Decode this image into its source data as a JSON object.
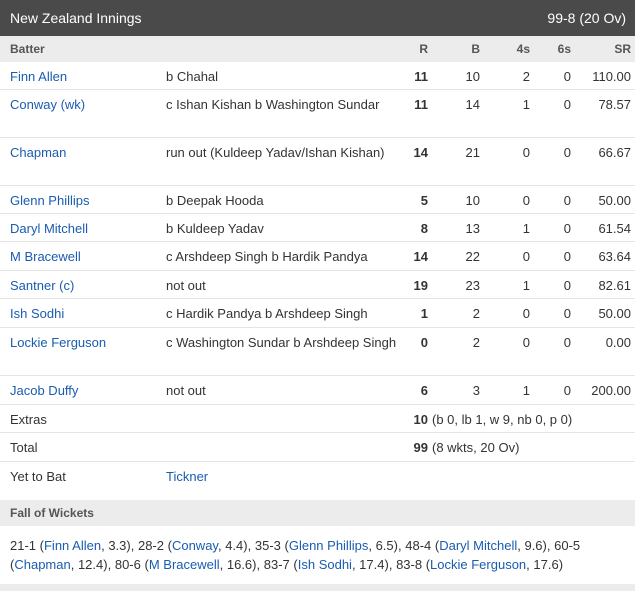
{
  "header": {
    "title": "New Zealand Innings",
    "score": "99-8 (20 Ov)"
  },
  "columns": {
    "batter": "Batter",
    "r": "R",
    "b": "B",
    "fours": "4s",
    "sixes": "6s",
    "sr": "SR"
  },
  "batters": [
    {
      "name": "Finn Allen",
      "dismissal": "b Chahal",
      "r": "11",
      "b": "10",
      "fours": "2",
      "sixes": "0",
      "sr": "110.00"
    },
    {
      "name": "Conway (wk)",
      "dismissal": "c Ishan Kishan b Washington Sundar",
      "r": "11",
      "b": "14",
      "fours": "1",
      "sixes": "0",
      "sr": "78.57"
    },
    {
      "name": "Chapman",
      "dismissal": "run out (Kuldeep Yadav/Ishan Kishan)",
      "r": "14",
      "b": "21",
      "fours": "0",
      "sixes": "0",
      "sr": "66.67"
    },
    {
      "name": "Glenn Phillips",
      "dismissal": "b Deepak Hooda",
      "r": "5",
      "b": "10",
      "fours": "0",
      "sixes": "0",
      "sr": "50.00"
    },
    {
      "name": "Daryl Mitchell",
      "dismissal": "b Kuldeep Yadav",
      "r": "8",
      "b": "13",
      "fours": "1",
      "sixes": "0",
      "sr": "61.54"
    },
    {
      "name": "M Bracewell",
      "dismissal": "c Arshdeep Singh b Hardik Pandya",
      "r": "14",
      "b": "22",
      "fours": "0",
      "sixes": "0",
      "sr": "63.64"
    },
    {
      "name": "Santner (c)",
      "dismissal": "not out",
      "r": "19",
      "b": "23",
      "fours": "1",
      "sixes": "0",
      "sr": "82.61"
    },
    {
      "name": "Ish Sodhi",
      "dismissal": "c Hardik Pandya b Arshdeep Singh",
      "r": "1",
      "b": "2",
      "fours": "0",
      "sixes": "0",
      "sr": "50.00"
    },
    {
      "name": "Lockie Ferguson",
      "dismissal": "c Washington Sundar b Arshdeep Singh",
      "r": "0",
      "b": "2",
      "fours": "0",
      "sixes": "0",
      "sr": "0.00"
    },
    {
      "name": "Jacob Duffy",
      "dismissal": "not out",
      "r": "6",
      "b": "3",
      "fours": "1",
      "sixes": "0",
      "sr": "200.00"
    }
  ],
  "extras": {
    "label": "Extras",
    "value": "10",
    "detail": "(b 0, lb 1, w 9, nb 0, p 0)"
  },
  "total": {
    "label": "Total",
    "value": "99",
    "detail": "(8 wkts, 20 Ov)"
  },
  "yet_to_bat": {
    "label": "Yet to Bat",
    "players": "Tickner"
  },
  "fow": {
    "title": "Fall of Wickets",
    "items": [
      {
        "score": "21-1",
        "name": "Finn Allen",
        "over": "3.3"
      },
      {
        "score": "28-2",
        "name": "Conway",
        "over": "4.4"
      },
      {
        "score": "35-3",
        "name": "Glenn Phillips",
        "over": "6.5"
      },
      {
        "score": "48-4",
        "name": "Daryl Mitchell",
        "over": "9.6"
      },
      {
        "score": "60-5",
        "name": "Chapman",
        "over": "12.4"
      },
      {
        "score": "80-6",
        "name": "M Bracewell",
        "over": "16.6"
      },
      {
        "score": "83-7",
        "name": "Ish Sodhi",
        "over": "17.4"
      },
      {
        "score": "83-8",
        "name": "Lockie Ferguson",
        "over": "17.6"
      }
    ]
  },
  "colors": {
    "header_bg": "#4a4a4a",
    "link": "#1a5cb0",
    "subheader_bg": "#ececec"
  }
}
